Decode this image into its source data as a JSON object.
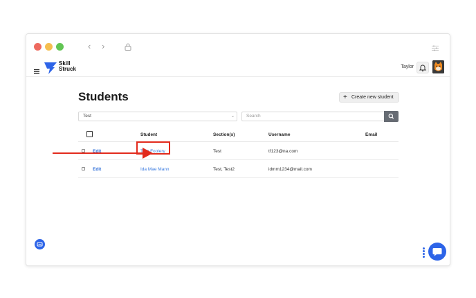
{
  "browser": {
    "back_icon": "chevron-left-icon",
    "forward_icon": "chevron-right-icon",
    "lock_icon": "lock-icon"
  },
  "app": {
    "logo_line1": "Skill",
    "logo_line2": "Struck",
    "user_name": "Taylor",
    "brand_color": "#2d64e8"
  },
  "page": {
    "title": "Students",
    "create_button": "Create new student"
  },
  "filters": {
    "section_value": "Test",
    "search_placeholder": "Search"
  },
  "table": {
    "headers": [
      "Student",
      "Section(s)",
      "Username",
      "Email"
    ],
    "rows": [
      {
        "action": "Edit",
        "student": "Tom Foolery",
        "sections": "Test",
        "username": "tf123@na.com",
        "email": ""
      },
      {
        "action": "Edit",
        "student": "Ida Mae Mann",
        "sections": "Test, Test2",
        "username": "idmm1234@mail.com",
        "email": ""
      }
    ]
  },
  "annotation": {
    "color": "#e22a1c",
    "target": "Tom Foolery"
  }
}
